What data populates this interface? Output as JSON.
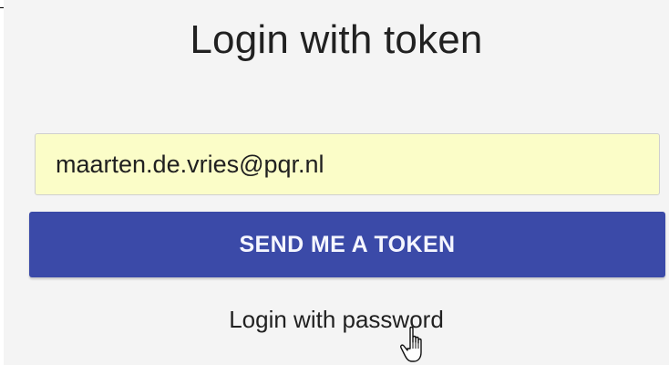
{
  "page": {
    "title": "Login with token"
  },
  "form": {
    "email_value": "maarten.de.vries@pqr.nl",
    "send_button_label": "SEND ME A TOKEN",
    "password_link_label": "Login with password"
  },
  "icons": {
    "cursor": "hand-pointer-icon"
  },
  "colors": {
    "button_background": "#3b4aa8",
    "input_background": "#fbfdc8",
    "page_background": "#f4f4f4"
  }
}
